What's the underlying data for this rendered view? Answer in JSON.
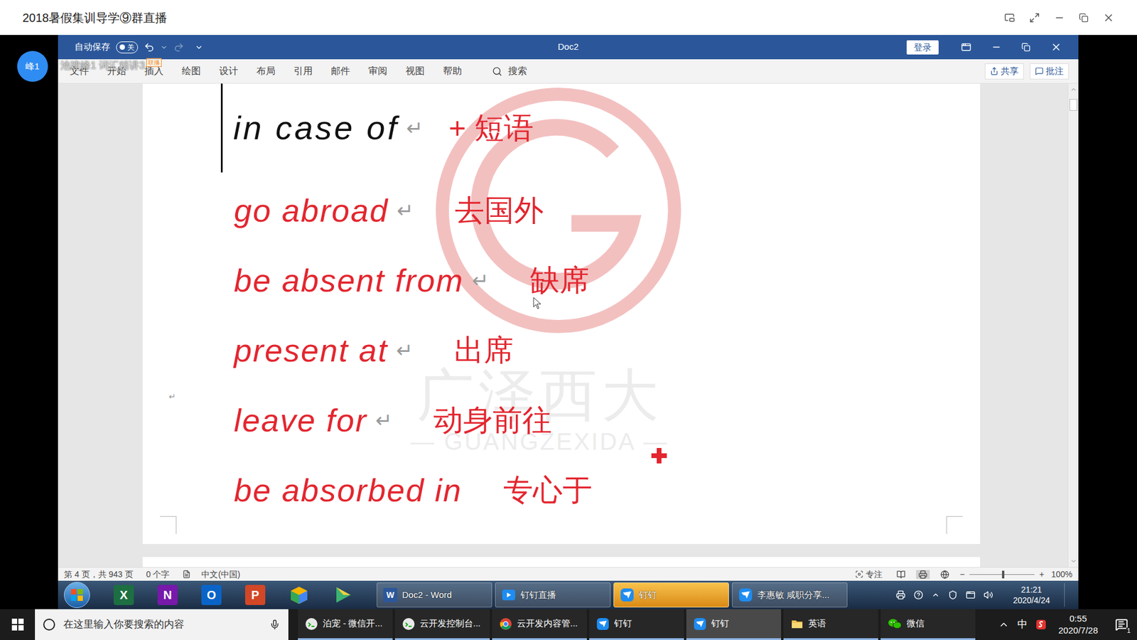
{
  "stream": {
    "title": "2018暑假集训导学⑨群直播",
    "avatar": "峰1",
    "overlay": "池建峰1 词汇精讲3",
    "overlay_badge": "联播"
  },
  "word": {
    "autosave": "自动保存",
    "autosave_toggle": "关",
    "autosave_on": false,
    "title": "Doc2",
    "login": "登录",
    "tabs": [
      {
        "label": "文件",
        "selected": false
      },
      {
        "label": "开始",
        "selected": false
      },
      {
        "label": "插入",
        "selected": false
      },
      {
        "label": "绘图",
        "selected": false
      },
      {
        "label": "设计",
        "selected": false
      },
      {
        "label": "布局",
        "selected": false
      },
      {
        "label": "引用",
        "selected": false
      },
      {
        "label": "邮件",
        "selected": false
      },
      {
        "label": "审阅",
        "selected": false
      },
      {
        "label": "视图",
        "selected": false
      },
      {
        "label": "帮助",
        "selected": false
      }
    ],
    "search": "搜索",
    "share": "共享",
    "comments": "批注"
  },
  "document": {
    "heading": {
      "en": "in case of",
      "zh": "+ 短语",
      "mark": "↵",
      "en_color": "#111111",
      "zh_color": "#e3262f"
    },
    "lines": [
      {
        "en": "go abroad",
        "mark": "↵",
        "zh": "去国外",
        "color": "#e3262f"
      },
      {
        "en": "be absent from",
        "mark": "↵",
        "zh": "缺席",
        "color": "#e3262f"
      },
      {
        "en": "present at",
        "mark": "↵",
        "zh": "出席",
        "color": "#e3262f"
      },
      {
        "en": "leave for",
        "mark": "↵",
        "zh": "动身前往",
        "color": "#e3262f"
      },
      {
        "en": "be absorbed in",
        "mark": "",
        "zh": "专心于",
        "color": "#e3262f"
      }
    ],
    "page_mark": "↵",
    "watermark": {
      "cn": "广泽西大",
      "en": "— GUANGZEXIDA —"
    }
  },
  "status_bar": {
    "page": "第 4 页，共 943 页",
    "words": "0 个字",
    "lang": "中文(中国)",
    "focus": "专注",
    "zoom_minus": "−",
    "zoom_plus": "+",
    "zoom": "100%",
    "zoom_level": 0.5
  },
  "inner_taskbar": {
    "pinned": [
      {
        "letter": "X",
        "color": "#1d6f42"
      },
      {
        "letter": "N",
        "color": "#7719aa"
      },
      {
        "letter": "O",
        "color": "#0a64c8"
      },
      {
        "letter": "P",
        "color": "#d24726"
      }
    ],
    "windows": [
      {
        "label": "Doc2 - Word",
        "kind": "word",
        "icon": "W",
        "selected": false
      },
      {
        "label": "钉钉直播",
        "kind": "live",
        "icon": "",
        "selected": false
      },
      {
        "label": "钉钉",
        "kind": "dingtalk",
        "icon": "",
        "selected": true
      },
      {
        "label": "李惠敏 咸职分享...",
        "kind": "dingtalk",
        "icon": "",
        "selected": false
      }
    ],
    "time": "21:21",
    "date": "2020/4/24"
  },
  "outer_taskbar": {
    "search": "在这里输入你要搜索的内容",
    "apps": [
      {
        "label": "泊宠 - 微信开...",
        "kind": "wechat-dev",
        "selected": false
      },
      {
        "label": "云开发控制台...",
        "kind": "wechat-dev",
        "selected": false
      },
      {
        "label": "云开发内容管...",
        "kind": "chrome",
        "selected": false
      },
      {
        "label": "钉钉",
        "kind": "dingtalk",
        "selected": false
      },
      {
        "label": "钉钉",
        "kind": "dingtalk",
        "selected": true
      },
      {
        "label": "英语",
        "kind": "folder",
        "selected": false
      },
      {
        "label": "微信",
        "kind": "wechat",
        "selected": false
      }
    ],
    "ime": "中",
    "time": "0:55",
    "date": "2020/7/28",
    "notifications": "1"
  }
}
